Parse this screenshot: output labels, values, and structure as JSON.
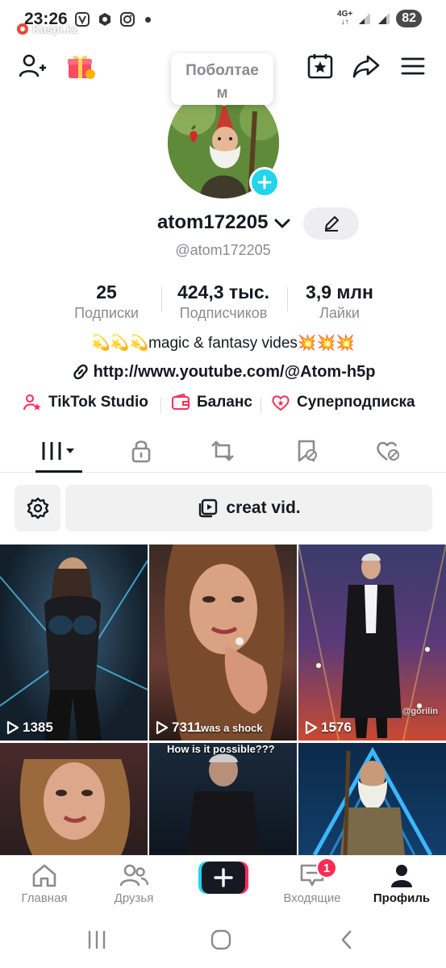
{
  "status_bar": {
    "time": "23:26",
    "kaspi": "Kaspi.kz",
    "network": "4G+",
    "battery": "82"
  },
  "top_nav": {
    "tooltip": "Поболтаем"
  },
  "profile": {
    "username": "atom172205",
    "handle": "@atom172205",
    "stats": [
      {
        "value": "25",
        "label": "Подписки"
      },
      {
        "value": "424,3 тыс.",
        "label": "Подписчиков"
      },
      {
        "value": "3,9 млн",
        "label": "Лайки"
      }
    ],
    "bio": "💫💫💫magic & fantasy vides💥💥💥",
    "link": "http://www.youtube.com/@Atom-h5p"
  },
  "quick_links": [
    {
      "label": "TikTok Studio",
      "icon": "person-star-icon"
    },
    {
      "label": "Баланс",
      "icon": "wallet-icon"
    },
    {
      "label": "Суперподписка",
      "icon": "heart-star-icon"
    }
  ],
  "tools": {
    "creat_label": "creat vid."
  },
  "videos": [
    {
      "views": "1385"
    },
    {
      "views": "7311",
      "overlay": "was a shock"
    },
    {
      "views": "1576",
      "overlay": "@gorilin"
    },
    {
      "views": "",
      "overlay": ""
    },
    {
      "views": "",
      "overlay": "How is it possible???"
    },
    {
      "views": "",
      "overlay": ""
    }
  ],
  "bottom_nav": {
    "items": [
      {
        "label": "Главная"
      },
      {
        "label": "Друзья"
      },
      {
        "label": ""
      },
      {
        "label": "Входящие"
      },
      {
        "label": "Профиль"
      }
    ],
    "inbox_badge": "1"
  },
  "colors": {
    "accent_pink": "#fe2c55",
    "accent_cyan": "#20d5ec",
    "text_secondary": "#8a8b91"
  }
}
